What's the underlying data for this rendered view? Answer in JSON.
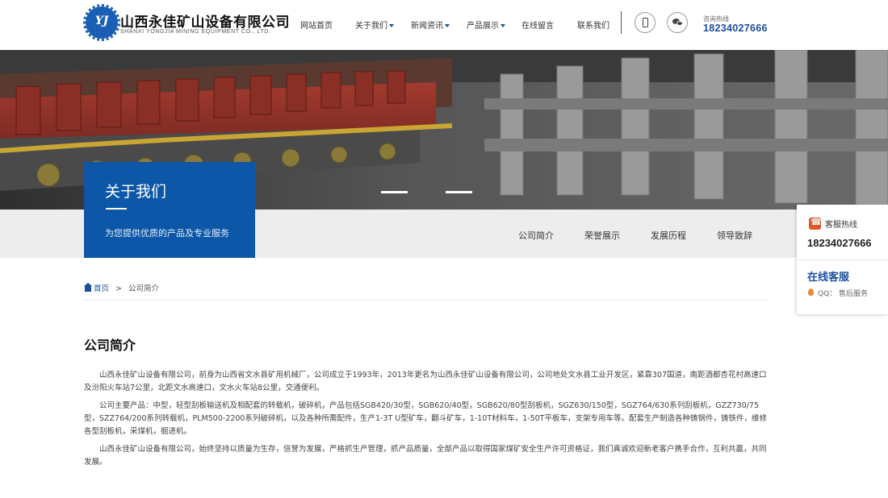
{
  "header": {
    "logo_mark": "YJ",
    "company_cn": "山西永佳矿山设备有限公司",
    "company_en": "SHANXI YONGJIA MINING EQUIPMENT CO., LTD.",
    "hotline_label": "咨询热线",
    "hotline_number": "18234027666"
  },
  "nav": {
    "items": [
      {
        "label": "网站首页",
        "has_caret": false
      },
      {
        "label": "关于我们",
        "has_caret": true
      },
      {
        "label": "新闻资讯",
        "has_caret": true
      },
      {
        "label": "产品展示",
        "has_caret": true
      },
      {
        "label": "在线留言",
        "has_caret": false
      },
      {
        "label": "联系我们",
        "has_caret": false
      }
    ]
  },
  "banner": {
    "slider_active": 1,
    "slider_count": 2
  },
  "about_box": {
    "title": "关于我们",
    "subtitle": "为您提供优质的产品及专业服务"
  },
  "subnav": {
    "items": [
      "公司简介",
      "荣誉展示",
      "发展历程",
      "领导致辞"
    ]
  },
  "breadcrumb": {
    "home": "首页",
    "separator": ">",
    "current": "公司简介"
  },
  "content": {
    "title": "公司简介",
    "paragraphs": [
      "山西永佳矿山设备有限公司，前身为山西省文水县矿用机械厂，公司成立于1993年，2013年更名为山西永佳矿山设备有限公司，公司地处文水县工业开发区，紧靠307国道，南距酒都杏花村高速口及汾阳火车站7公里，北距文水高速口，文水火车站8公里，交通便利。",
      "公司主要产品：中型，轻型刮板输送机及相配套的转载机，破碎机，产品包括SGB420/30型，SGB620/40型，SGB620/80型刮板机，SGZ630/150型，SGZ764/630系列刮板机，GZZ730/75型，SZZ764/200系列转载机，PLM500-2200系列破碎机，以及各种所需配件，生产1-3T U型矿车，翻斗矿车，1-10T材料车，1-50T平板车，支架专用车等。配套生产制造各种铸钢件，铸铁件，维修各型刮板机，采煤机，掘进机。",
      "山西永佳矿山设备有限公司，始终坚持以质量为生存，信誉为发展，严格抓生产管理，抓产品质量，全部产品以取得国家煤矿安全生产许可资格证，我们真诚欢迎新老客户携手合作，互利共赢，共同发展。"
    ]
  },
  "float_panel": {
    "service_label": "客服热线",
    "service_number": "18234027666",
    "online_label": "在线客服",
    "qq_label": "QQ：",
    "qq_value": "售后服务"
  },
  "colors": {
    "brand_blue": "#0c57a8",
    "accent_orange": "#e2572a",
    "text_dark": "#333333"
  },
  "icons": {
    "header_phone": "mobile-phone-icon",
    "header_wechat": "wechat-icon",
    "breadcrumb_home": "home-icon",
    "float_phone": "phone-icon",
    "float_qq": "qq-icon"
  }
}
